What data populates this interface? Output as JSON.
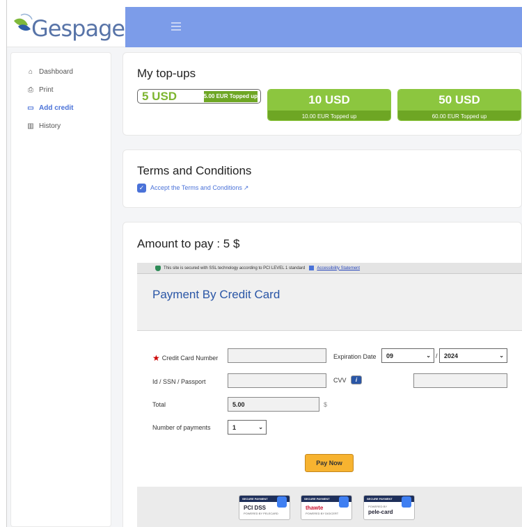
{
  "app": {
    "logo_text": "Gespage"
  },
  "sidebar": {
    "items": [
      {
        "label": "Dashboard",
        "icon": "home-icon",
        "active": false
      },
      {
        "label": "Print",
        "icon": "printer-icon",
        "active": false
      },
      {
        "label": "Add credit",
        "icon": "credit-card-icon",
        "active": true
      },
      {
        "label": "History",
        "icon": "bar-chart-icon",
        "active": false
      }
    ]
  },
  "topups": {
    "title": "My top-ups",
    "options": [
      {
        "amount": "5 USD",
        "subtitle": "5.00 EUR Topped up",
        "selected": true
      },
      {
        "amount": "10 USD",
        "subtitle": "10.00 EUR Topped up",
        "selected": false
      },
      {
        "amount": "50 USD",
        "subtitle": "60.00 EUR Topped up",
        "selected": false
      }
    ]
  },
  "terms": {
    "title": "Terms and Conditions",
    "checkbox_label": "Accept the Terms and Conditions",
    "checked": true
  },
  "payment": {
    "title": "Amount to pay : 5 $",
    "ssl_text": "This site is secured with SSL technology according to PCI LEVEL 1 standard",
    "accessibility_link": "Accessibility Statement",
    "header_title": "Payment By Credit Card",
    "form": {
      "card_number_label": "Credit Card Number",
      "card_number_value": "",
      "expiration_label": "Expiration Date",
      "exp_month": "09",
      "exp_sep": "/",
      "exp_year": "2024",
      "id_label": "Id / SSN / Passport",
      "id_value": "",
      "cvv_label": "CVV",
      "cvv_value": "",
      "total_label": "Total",
      "total_value": "5.00",
      "currency": "$",
      "payments_label": "Number of payments",
      "payments_value": "1"
    },
    "pay_button": "Pay Now",
    "badges": [
      {
        "header": "SECURE PAYMENT",
        "body": "PCI DSS",
        "sub": "POWERED BY PELECARD"
      },
      {
        "header": "SECURE PAYMENT",
        "body": "thawte",
        "sub": "POWERED BY DIGICERT"
      },
      {
        "header": "SECURE PAYMENT",
        "body": "pele-card",
        "sub": "POWERED BY"
      }
    ]
  },
  "colors": {
    "header": "#7c9ce9",
    "accent": "#4a72d8",
    "topup_green": "#8cc63f",
    "pay_button": "#f7b330"
  }
}
